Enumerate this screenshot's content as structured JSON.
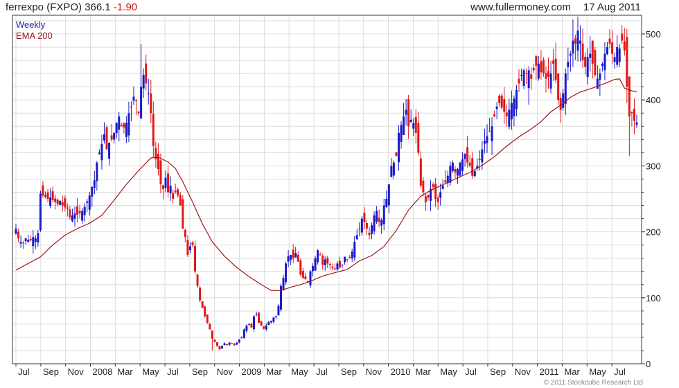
{
  "header": {
    "name": "ferrexpo",
    "ticker": "(FXPO)",
    "price": "366.1",
    "change": "-1.90",
    "site": "www.fullermoney.com",
    "date": "17 Aug 2011"
  },
  "credit": "© 2011 Stockcube Research Ltd",
  "colors": {
    "up": "#1a1acc",
    "down": "#e01818",
    "ema": "#a01818",
    "grid": "#dcdcdc",
    "axis": "#333333"
  },
  "chart_data": {
    "type": "candlestick",
    "legend": [
      "Weekly",
      "EMA 200"
    ],
    "ylim": [
      0,
      520
    ],
    "yticks": [
      0,
      100,
      200,
      300,
      400,
      500
    ],
    "x_tick_labels": [
      "Jul",
      "Sep",
      "Nov",
      "2008",
      "Mar",
      "May",
      "Jul",
      "Sep",
      "Nov",
      "2009",
      "Mar",
      "May",
      "Jul",
      "Sep",
      "Nov",
      "2010",
      "Mar",
      "May",
      "Jul",
      "Sep",
      "Nov",
      "2011",
      "Mar",
      "May",
      "Jul"
    ],
    "close_path": [
      [
        0,
        205
      ],
      [
        1,
        190
      ],
      [
        2,
        185
      ],
      [
        3,
        183
      ],
      [
        4,
        190
      ],
      [
        5,
        188
      ],
      [
        6,
        187
      ],
      [
        7,
        192
      ],
      [
        8,
        190
      ],
      [
        9,
        198
      ],
      [
        10,
        258
      ],
      [
        11,
        255
      ],
      [
        12,
        253
      ],
      [
        13,
        250
      ],
      [
        14,
        252
      ],
      [
        15,
        248
      ],
      [
        16,
        245
      ],
      [
        17,
        242
      ],
      [
        18,
        247
      ],
      [
        19,
        240
      ],
      [
        20,
        237
      ],
      [
        21,
        235
      ],
      [
        22,
        222
      ],
      [
        23,
        225
      ],
      [
        24,
        228
      ],
      [
        25,
        226
      ],
      [
        26,
        228
      ],
      [
        27,
        232
      ],
      [
        28,
        238
      ],
      [
        29,
        246
      ],
      [
        30,
        255
      ],
      [
        31,
        268
      ],
      [
        32,
        278
      ],
      [
        33,
        305
      ],
      [
        34,
        320
      ],
      [
        35,
        333
      ],
      [
        36,
        348
      ],
      [
        37,
        325
      ],
      [
        38,
        335
      ],
      [
        39,
        340
      ],
      [
        40,
        350
      ],
      [
        41,
        365
      ],
      [
        42,
        375
      ],
      [
        43,
        360
      ],
      [
        44,
        358
      ],
      [
        45,
        365
      ],
      [
        46,
        380
      ],
      [
        47,
        390
      ],
      [
        48,
        405
      ],
      [
        49,
        398
      ],
      [
        50,
        380
      ],
      [
        51,
        420
      ],
      [
        52,
        438
      ],
      [
        53,
        425
      ],
      [
        54,
        410
      ],
      [
        55,
        380
      ],
      [
        56,
        330
      ],
      [
        57,
        310
      ],
      [
        58,
        295
      ],
      [
        59,
        272
      ],
      [
        60,
        265
      ],
      [
        61,
        282
      ],
      [
        62,
        260
      ],
      [
        63,
        270
      ],
      [
        64,
        250
      ],
      [
        65,
        260
      ],
      [
        66,
        255
      ],
      [
        67,
        240
      ],
      [
        68,
        205
      ],
      [
        69,
        192
      ],
      [
        70,
        165
      ],
      [
        71,
        178
      ],
      [
        72,
        180
      ],
      [
        73,
        140
      ],
      [
        74,
        118
      ],
      [
        75,
        96
      ],
      [
        76,
        85
      ],
      [
        77,
        72
      ],
      [
        78,
        62
      ],
      [
        79,
        52
      ],
      [
        80,
        38
      ],
      [
        81,
        33
      ],
      [
        82,
        27
      ],
      [
        83,
        22
      ],
      [
        84,
        27
      ],
      [
        85,
        31
      ],
      [
        86,
        28
      ],
      [
        87,
        32
      ],
      [
        88,
        31
      ],
      [
        89,
        28
      ],
      [
        90,
        32
      ],
      [
        91,
        37
      ],
      [
        92,
        40
      ],
      [
        93,
        52
      ],
      [
        94,
        58
      ],
      [
        95,
        60
      ],
      [
        96,
        55
      ],
      [
        97,
        72
      ],
      [
        98,
        75
      ],
      [
        99,
        62
      ],
      [
        100,
        58
      ],
      [
        101,
        53
      ],
      [
        102,
        58
      ],
      [
        103,
        63
      ],
      [
        104,
        65
      ],
      [
        105,
        70
      ],
      [
        106,
        72
      ],
      [
        107,
        88
      ],
      [
        108,
        118
      ],
      [
        109,
        130
      ],
      [
        110,
        152
      ],
      [
        111,
        163
      ],
      [
        112,
        165
      ],
      [
        113,
        160
      ],
      [
        114,
        168
      ],
      [
        115,
        155
      ],
      [
        116,
        135
      ],
      [
        117,
        130
      ],
      [
        118,
        128
      ],
      [
        119,
        125
      ],
      [
        120,
        140
      ],
      [
        121,
        148
      ],
      [
        122,
        160
      ],
      [
        123,
        172
      ],
      [
        124,
        165
      ],
      [
        125,
        150
      ],
      [
        126,
        158
      ],
      [
        127,
        152
      ],
      [
        128,
        150
      ],
      [
        129,
        145
      ],
      [
        130,
        143
      ],
      [
        131,
        152
      ],
      [
        132,
        146
      ],
      [
        133,
        150
      ],
      [
        134,
        162
      ],
      [
        135,
        158
      ],
      [
        136,
        160
      ],
      [
        137,
        170
      ],
      [
        138,
        185
      ],
      [
        139,
        195
      ],
      [
        140,
        205
      ],
      [
        141,
        220
      ],
      [
        142,
        215
      ],
      [
        143,
        205
      ],
      [
        144,
        195
      ],
      [
        145,
        210
      ],
      [
        146,
        225
      ],
      [
        147,
        232
      ],
      [
        148,
        215
      ],
      [
        149,
        218
      ],
      [
        150,
        240
      ],
      [
        151,
        250
      ],
      [
        152,
        272
      ],
      [
        153,
        300
      ],
      [
        154,
        305
      ],
      [
        155,
        315
      ],
      [
        156,
        350
      ],
      [
        157,
        362
      ],
      [
        158,
        375
      ],
      [
        159,
        385
      ],
      [
        160,
        360
      ],
      [
        161,
        370
      ],
      [
        162,
        365
      ],
      [
        163,
        350
      ],
      [
        164,
        320
      ],
      [
        165,
        270
      ],
      [
        166,
        260
      ],
      [
        167,
        245
      ],
      [
        168,
        252
      ],
      [
        169,
        265
      ],
      [
        170,
        268
      ],
      [
        171,
        250
      ],
      [
        172,
        245
      ],
      [
        173,
        260
      ],
      [
        174,
        270
      ],
      [
        175,
        275
      ],
      [
        176,
        285
      ],
      [
        177,
        300
      ],
      [
        178,
        305
      ],
      [
        179,
        290
      ],
      [
        180,
        295
      ],
      [
        181,
        305
      ],
      [
        182,
        310
      ],
      [
        183,
        318
      ],
      [
        184,
        305
      ],
      [
        185,
        300
      ],
      [
        186,
        285
      ],
      [
        187,
        292
      ],
      [
        188,
        300
      ],
      [
        189,
        310
      ],
      [
        190,
        325
      ],
      [
        191,
        338
      ],
      [
        192,
        345
      ],
      [
        193,
        352
      ],
      [
        194,
        360
      ],
      [
        195,
        375
      ],
      [
        196,
        390
      ],
      [
        197,
        395
      ],
      [
        198,
        388
      ],
      [
        199,
        382
      ],
      [
        200,
        375
      ],
      [
        201,
        385
      ],
      [
        202,
        395
      ],
      [
        203,
        402
      ],
      [
        204,
        415
      ],
      [
        205,
        425
      ],
      [
        206,
        438
      ],
      [
        207,
        445
      ],
      [
        208,
        440
      ],
      [
        209,
        445
      ],
      [
        210,
        432
      ],
      [
        211,
        445
      ],
      [
        212,
        452
      ],
      [
        213,
        455
      ],
      [
        214,
        442
      ],
      [
        215,
        440
      ],
      [
        216,
        432
      ],
      [
        217,
        435
      ],
      [
        218,
        440
      ],
      [
        219,
        455
      ],
      [
        220,
        430
      ],
      [
        221,
        400
      ],
      [
        222,
        385
      ],
      [
        223,
        410
      ],
      [
        224,
        440
      ],
      [
        225,
        458
      ],
      [
        226,
        470
      ],
      [
        227,
        490
      ],
      [
        228,
        485
      ],
      [
        229,
        505
      ],
      [
        230,
        490
      ],
      [
        231,
        460
      ],
      [
        232,
        450
      ],
      [
        233,
        465
      ],
      [
        234,
        470
      ],
      [
        235,
        455
      ],
      [
        236,
        438
      ],
      [
        237,
        432
      ],
      [
        238,
        440
      ],
      [
        239,
        455
      ],
      [
        240,
        470
      ],
      [
        241,
        480
      ],
      [
        242,
        485
      ],
      [
        243,
        470
      ],
      [
        244,
        465
      ],
      [
        245,
        480
      ],
      [
        246,
        478
      ],
      [
        247,
        490
      ],
      [
        248,
        475
      ],
      [
        249,
        420
      ],
      [
        250,
        375
      ],
      [
        251,
        380
      ],
      [
        252,
        368
      ],
      [
        253,
        366
      ]
    ],
    "ema_path": [
      [
        0,
        142
      ],
      [
        5,
        152
      ],
      [
        10,
        162
      ],
      [
        15,
        180
      ],
      [
        20,
        195
      ],
      [
        25,
        205
      ],
      [
        30,
        213
      ],
      [
        35,
        225
      ],
      [
        40,
        248
      ],
      [
        45,
        272
      ],
      [
        50,
        293
      ],
      [
        55,
        312
      ],
      [
        58,
        313
      ],
      [
        62,
        306
      ],
      [
        65,
        296
      ],
      [
        68,
        276
      ],
      [
        72,
        245
      ],
      [
        76,
        212
      ],
      [
        80,
        185
      ],
      [
        85,
        163
      ],
      [
        90,
        146
      ],
      [
        95,
        132
      ],
      [
        100,
        120
      ],
      [
        104,
        111
      ],
      [
        108,
        111
      ],
      [
        112,
        116
      ],
      [
        116,
        120
      ],
      [
        120,
        125
      ],
      [
        125,
        133
      ],
      [
        130,
        138
      ],
      [
        135,
        143
      ],
      [
        140,
        156
      ],
      [
        145,
        164
      ],
      [
        150,
        178
      ],
      [
        155,
        202
      ],
      [
        160,
        233
      ],
      [
        165,
        254
      ],
      [
        170,
        265
      ],
      [
        175,
        273
      ],
      [
        180,
        282
      ],
      [
        185,
        290
      ],
      [
        190,
        301
      ],
      [
        195,
        314
      ],
      [
        200,
        330
      ],
      [
        205,
        344
      ],
      [
        210,
        356
      ],
      [
        214,
        367
      ],
      [
        218,
        382
      ],
      [
        222,
        392
      ],
      [
        226,
        404
      ],
      [
        230,
        412
      ],
      [
        235,
        418
      ],
      [
        240,
        425
      ],
      [
        244,
        431
      ],
      [
        246,
        432
      ],
      [
        248,
        418
      ],
      [
        250,
        415
      ],
      [
        253,
        412
      ]
    ],
    "highlights": [
      {
        "i": 51,
        "high": 485,
        "low": 395
      },
      {
        "i": 80,
        "high": 42,
        "low": 20
      },
      {
        "i": 227,
        "high": 522,
        "low": 450
      },
      {
        "i": 250,
        "high": 390,
        "low": 315
      },
      {
        "i": 158,
        "high": 395,
        "low": 355
      }
    ]
  }
}
